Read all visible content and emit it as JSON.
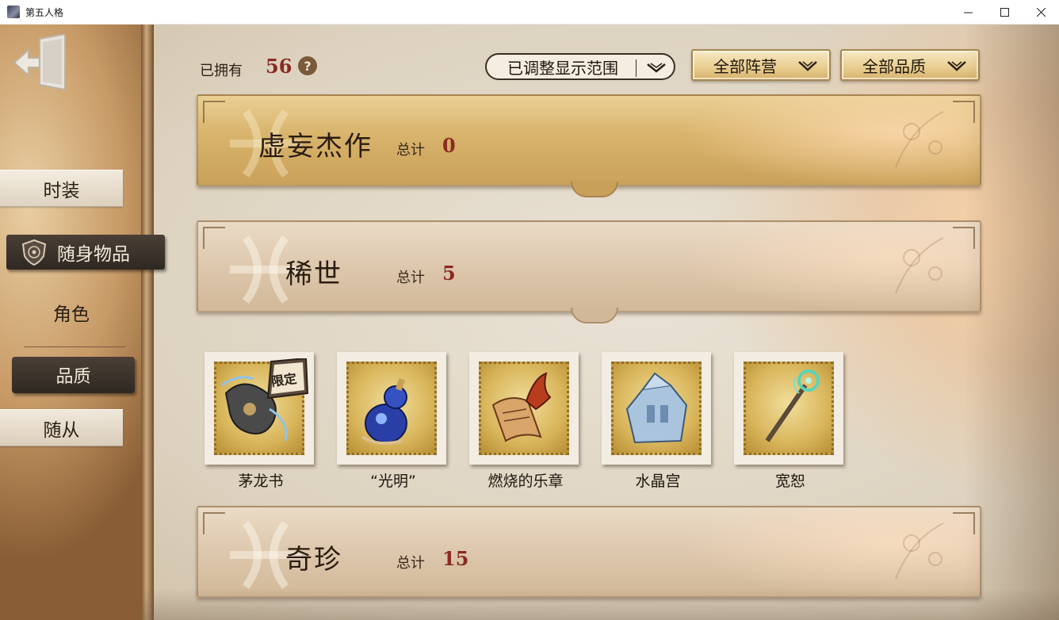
{
  "window": {
    "title": "第五人格",
    "minimize_icon": "minimize-icon",
    "maximize_icon": "maximize-icon",
    "close_icon": "close-icon"
  },
  "sidebar": {
    "back_icon": "exit-door-icon",
    "items": [
      {
        "label": "时装",
        "state": "normal"
      },
      {
        "label": "随身物品",
        "state": "selected",
        "icon": "shield-crest-icon"
      },
      {
        "label": "角色",
        "state": "plain"
      },
      {
        "label": "品质",
        "state": "selected"
      },
      {
        "label": "随从",
        "state": "normal"
      }
    ]
  },
  "header": {
    "owned_label": "已拥有",
    "owned_count": "56",
    "help_symbol": "?",
    "range_dropdown": "已调整显示范围",
    "camp_dropdown": "全部阵营",
    "quality_dropdown": "全部品质"
  },
  "categories": [
    {
      "title": "虚妄杰作",
      "total_label": "总计",
      "total": "0",
      "style": "gold"
    },
    {
      "title": "稀世",
      "total_label": "总计",
      "total": "5",
      "style": "light"
    },
    {
      "title": "奇珍",
      "total_label": "总计",
      "total": "15",
      "style": "light"
    }
  ],
  "items": [
    {
      "name": "茅龙书",
      "badge": "限定",
      "icon": "mao-long-book-icon"
    },
    {
      "name": "“光明”",
      "icon": "blue-gourd-icon"
    },
    {
      "name": "燃烧的乐章",
      "icon": "burning-score-icon"
    },
    {
      "name": "水晶宫",
      "icon": "crystal-palace-icon"
    },
    {
      "name": "宽恕",
      "icon": "forgiveness-staff-icon"
    }
  ],
  "colors": {
    "count_red": "#8a2a22",
    "gold_banner": "#d8b36b",
    "dark_tab": "#3b332b"
  }
}
